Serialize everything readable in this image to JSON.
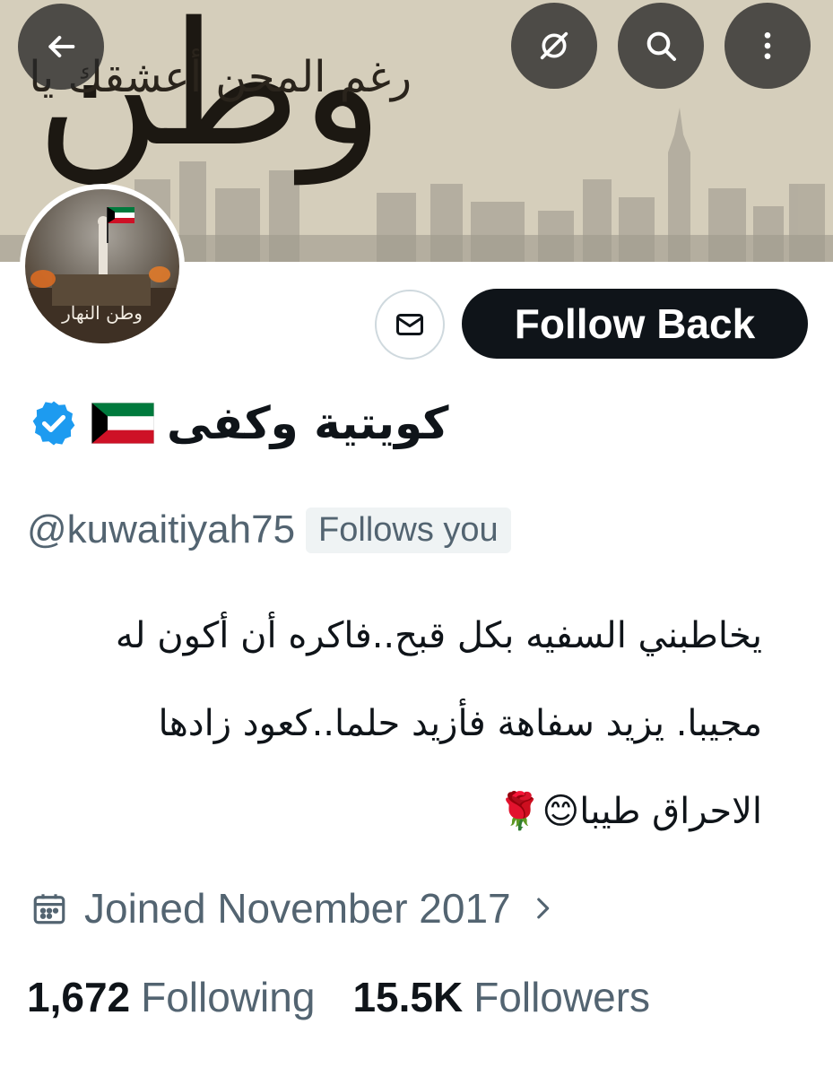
{
  "banner": {
    "calligraphy_word": "وطن",
    "phrase": "رغم المحن أعشقك يا"
  },
  "top_actions": {
    "back_icon": "arrow-left-icon",
    "grok_icon": "grok-icon",
    "search_icon": "search-icon",
    "more_icon": "more-vertical-icon"
  },
  "avatar": {
    "caption": "وطن النهار"
  },
  "actions": {
    "message_icon": "envelope-icon",
    "follow_label": "Follow Back"
  },
  "profile": {
    "display_name": "كويتية وكفى",
    "flag": "kuwait-flag",
    "verified": true,
    "handle": "@kuwaitiyah75",
    "follows_you": "Follows you",
    "bio_lines": [
      "يخاطبني السفيه بكل قبح..فاكره أن أكون له",
      "مجيبا. يزيد سفاهة فأزيد حلما..كعود زادها",
      "الاحراق طيبا😊🌹"
    ],
    "joined": "Joined November 2017"
  },
  "stats": {
    "following_count": "1,672",
    "following_label": "Following",
    "followers_count": "15.5K",
    "followers_label": "Followers"
  },
  "colors": {
    "primary_text": "#0f1419",
    "secondary_text": "#536471",
    "verified_blue": "#1d9bf0",
    "kuwait_green": "#007a3d",
    "kuwait_red": "#ce1126"
  }
}
